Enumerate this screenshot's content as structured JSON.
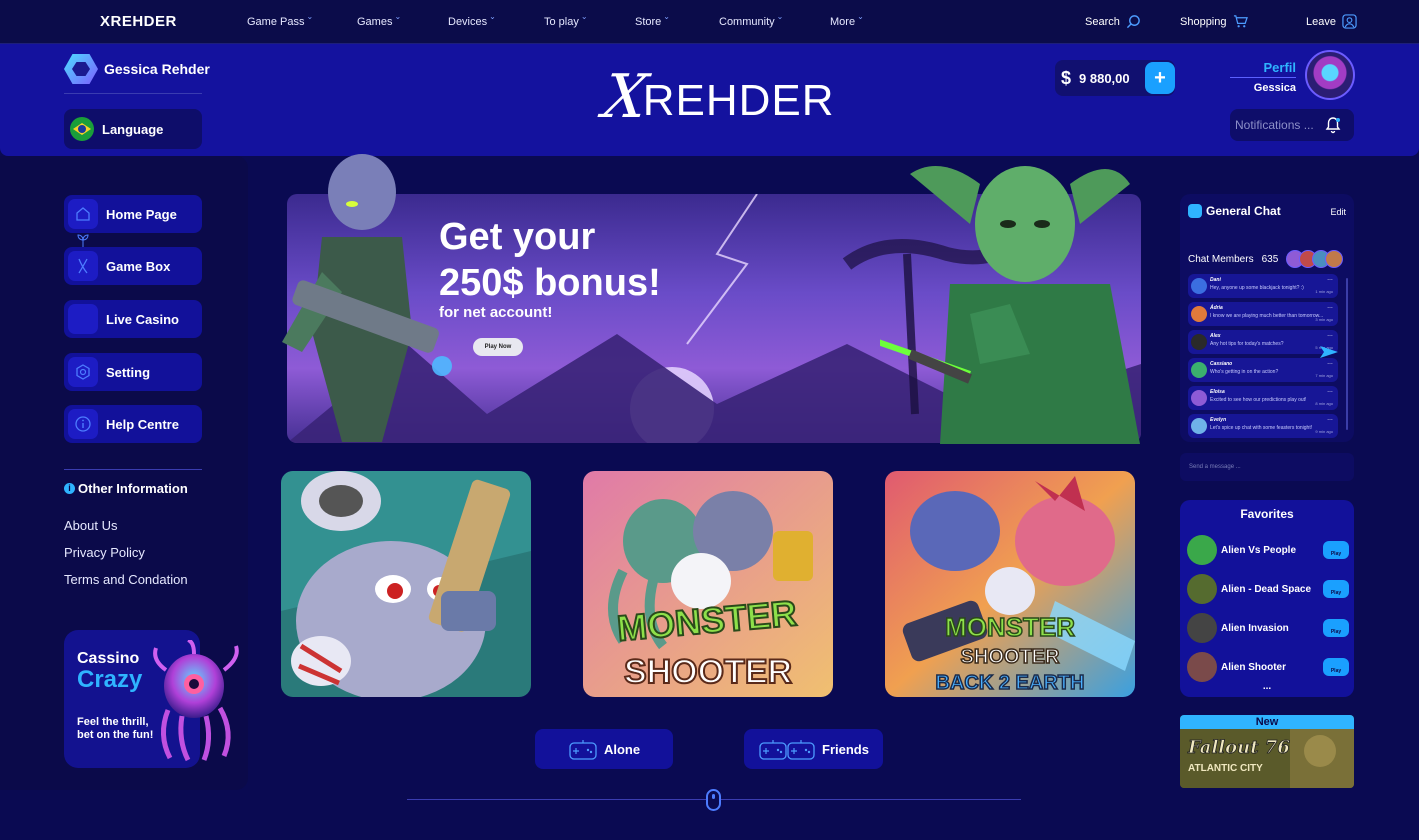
{
  "topnav": {
    "logo": "XREHDER",
    "items": [
      "Game Pass",
      "Games",
      "Devices",
      "To play",
      "Store",
      "Community",
      "More"
    ],
    "search": "Search",
    "shopping": "Shopping",
    "leave": "Leave"
  },
  "header": {
    "username_brand": "Gessica Rehder",
    "language": "Language",
    "logo_mark": "X",
    "logo_word": "REHDER",
    "currency": "$",
    "balance": "9 880,00",
    "add_funds": "+",
    "profile_label": "Perfil",
    "profile_name": "Gessica",
    "notifications_placeholder": "Notifications ..."
  },
  "sidebar": {
    "items": [
      {
        "label": "Home Page",
        "icon": "home-icon"
      },
      {
        "label": "Game Box",
        "icon": "x-logo-icon"
      },
      {
        "label": "Live Casino",
        "icon": "casino-icon"
      },
      {
        "label": "Setting",
        "icon": "hexagon-settings-icon"
      },
      {
        "label": "Help Centre",
        "icon": "info-icon"
      }
    ],
    "other_info_title": "Other Information",
    "links": [
      "About Us",
      "Privacy Policy",
      "Terms and Condation"
    ],
    "promo": {
      "title": "Cassino",
      "highlight": "Crazy",
      "tagline": "Feel the thrill, bet on the fun!"
    }
  },
  "banner": {
    "headline_line1": "Get your",
    "headline_line2": "250$ bonus!",
    "subline": "for net account!",
    "cta": "Play Now"
  },
  "games": [
    {
      "title": "",
      "image": "robot-gunner-art"
    },
    {
      "title": "MONSTER SHOOTER",
      "image": "monster-shooter-art"
    },
    {
      "title": "MONSTER SHOOTER BACK 2 EARTH",
      "image": "monster-shooter-2-art"
    }
  ],
  "modes": {
    "alone": "Alone",
    "friends": "Friends"
  },
  "chat": {
    "title": "General Chat",
    "edit": "Edit",
    "members_label": "Chat Members",
    "members_count": "635",
    "messages": [
      {
        "name": "Dani",
        "text": "Hey, anyone up some blackjack tonight? :)",
        "time": "1 min ago",
        "color": "#3b6ee0"
      },
      {
        "name": "Ádria",
        "text": "I know we are playing much better than tomorrow...",
        "time": "3 min ago",
        "color": "#e07a3b"
      },
      {
        "name": "Alex",
        "text": "Any hot tips for today's matches?",
        "time": "5 min ago",
        "color": "#2a2a2a"
      },
      {
        "name": "Cassiano",
        "text": "Who's getting in on the action?",
        "time": "7 min ago",
        "color": "#3bb06e"
      },
      {
        "name": "Eloisa",
        "text": "Excited to see how our predictions play out!",
        "time": "8 min ago",
        "color": "#8e5bd6"
      },
      {
        "name": "Evelyn",
        "text": "Let's spice up chat with some feasters tonight!",
        "time": "9 min ago",
        "color": "#6fb2e8"
      }
    ],
    "input_placeholder": "Send a message ..."
  },
  "favorites": {
    "title": "Favorites",
    "items": [
      {
        "name": "Alien Vs People",
        "play": "Play",
        "color": "#3aa84a"
      },
      {
        "name": "Alien - Dead Space",
        "play": "Play",
        "color": "#556b2f"
      },
      {
        "name": "Alien Invasion",
        "play": "Play",
        "color": "#444444"
      },
      {
        "name": "Alien Shooter",
        "play": "Play",
        "color": "#7a4a4a"
      }
    ],
    "more": "..."
  },
  "new_card": {
    "label": "New",
    "title": "Fallout 76",
    "subtitle": "ATLANTIC CITY"
  }
}
